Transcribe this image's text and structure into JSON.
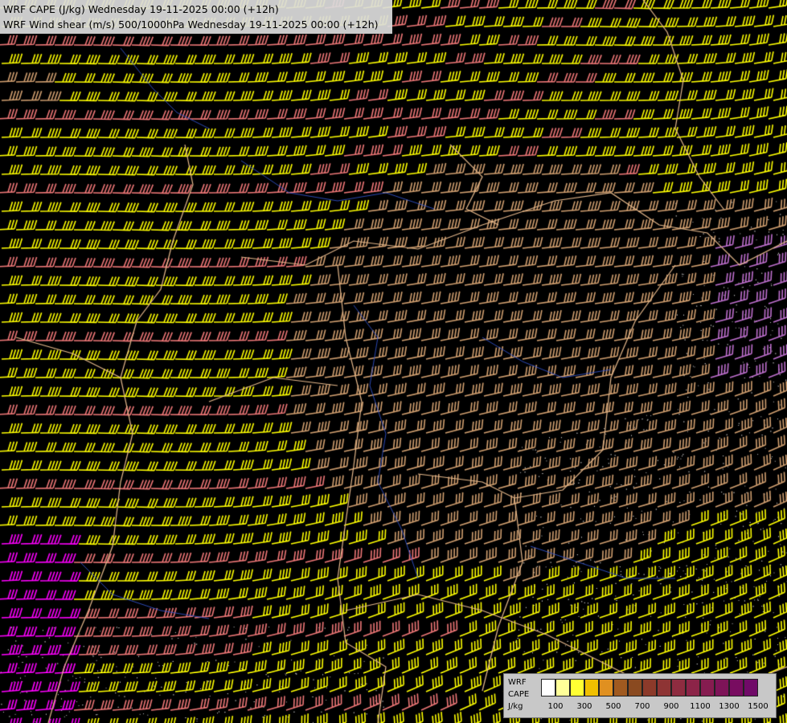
{
  "header": {
    "line1": "WRF CAPE (J/kg) Wednesday 19-11-2025 00:00 (+12h)",
    "line2": "WRF Wind shear (m/s) 500/1000hPa Wednesday 19-11-2025 00:00 (+12h)"
  },
  "legend": {
    "label_model": "WRF",
    "label_var": "CAPE",
    "label_unit": "J/kg",
    "colors": [
      "#ffffff",
      "#ffff99",
      "#ffff33",
      "#f0c000",
      "#e09020",
      "#a05a20",
      "#8a4a20",
      "#8c3a2a",
      "#8e3434",
      "#8e2c40",
      "#8c2448",
      "#861c50",
      "#7e1458",
      "#780c60",
      "#700a68"
    ],
    "ticks": [
      "100",
      "300",
      "500",
      "700",
      "900",
      "1100",
      "1300",
      "1500"
    ]
  },
  "map": {
    "background": "#000000",
    "border_color": "#e6b98c",
    "river_color": "#3050c8",
    "barb_colors": {
      "yellow": "#ffff00",
      "salmon": "#f07878",
      "tan": "#d2a070",
      "magenta": "#ff00ff",
      "violet": "#c070d0"
    }
  }
}
